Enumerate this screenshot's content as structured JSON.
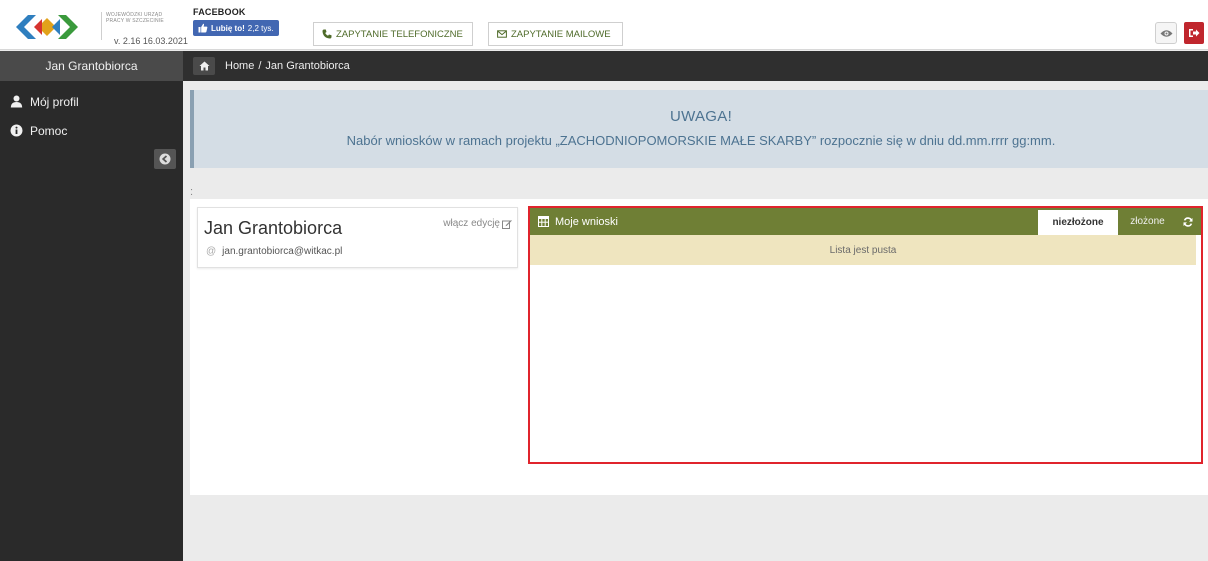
{
  "header": {
    "logo_text": "WOJEWÓDZKI URZĄD PRACY W SZCZECINIE",
    "version": "v. 2.16 16.03.2021",
    "facebook_title": "FACEBOOK",
    "like_label": "Lubię to!",
    "like_count": "2,2 tys.",
    "phone_button": "ZAPYTANIE TELEFONICZNE",
    "mail_button": "ZAPYTANIE MAILOWE"
  },
  "sidebar": {
    "user_name": "Jan Grantobiorca",
    "items": [
      {
        "label": "Mój profil",
        "icon": "user-icon"
      },
      {
        "label": "Pomoc",
        "icon": "info-icon"
      }
    ]
  },
  "breadcrumb": {
    "home": "Home",
    "separator": "/",
    "current": "Jan Grantobiorca"
  },
  "alert": {
    "title": "UWAGA!",
    "message": "Nabór wniosków w ramach projektu „ZACHODNIOPOMORSKIE MAŁE SKARBY” rozpocznie się w dniu dd.mm.rrrr gg:mm."
  },
  "colon_text": ":",
  "profile": {
    "name": "Jan Grantobiorca",
    "edit_label": "włącz edycję",
    "email_symbol": "@",
    "email": "jan.grantobiorca@witkac.pl"
  },
  "applications": {
    "title": "Moje wnioski",
    "tab_unsubmitted": "niezłożone",
    "tab_submitted": "złożone",
    "empty_message": "Lista jest pusta"
  },
  "colors": {
    "panel_header": "#6f7f35",
    "highlight_border": "#e0242c",
    "logout": "#c0262d",
    "alert_bg": "#d4dde5",
    "empty_bg": "#efe5bf"
  }
}
